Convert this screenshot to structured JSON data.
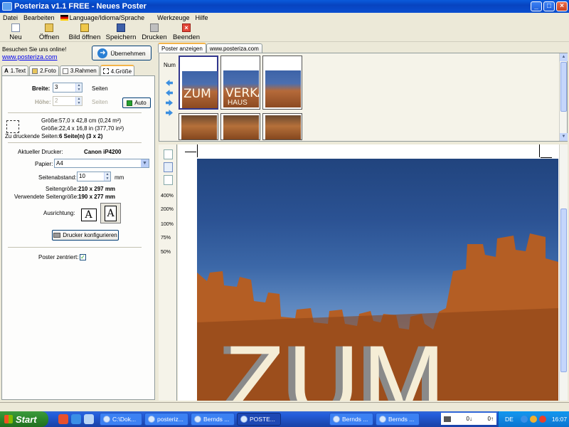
{
  "window": {
    "title": "Posteriza v1.1 FREE - Neues Poster",
    "controls": [
      "_",
      "□",
      "×"
    ]
  },
  "menu": {
    "items": [
      "Datei",
      "Bearbeiten",
      "Language/Idioma/Sprache",
      "Werkzeuge",
      "Hilfe"
    ]
  },
  "toolbar": {
    "new": "Neu",
    "open": "Öffnen",
    "open_image": "Bild öffnen",
    "save": "Speichern",
    "print": "Drucken",
    "quit": "Beenden"
  },
  "left": {
    "visit_text": "Besuchen Sie uns online!",
    "visit_link": "www.posteriza.com",
    "apply_button": "Übernehmen",
    "tabs": [
      "1.Text",
      "2.Foto",
      "3.Rahmen",
      "4.Größe"
    ],
    "width_label": "Breite:",
    "width_value": "3",
    "width_unit": "Seiten",
    "height_label": "Höhe:",
    "height_value": "2",
    "height_unit": "Seiten",
    "auto_button": "Auto",
    "size_label_1": "Größe:",
    "size_value_1": "57,0 x 42,8 cm (0,24 m²)",
    "size_label_2": "Größe:",
    "size_value_2": "22,4 x 16,8 in (377,70 in²)",
    "pages_label": "Zu druckende Seiten:",
    "pages_value": "6 Seite(n) (3 x 2)",
    "printer_label": "Aktueller Drucker:",
    "printer_value": "Canon iP4200",
    "paper_label": "Papier:",
    "paper_value": "A4",
    "margin_label": "Seitenabstand:",
    "margin_value": "10",
    "margin_unit": "mm",
    "pagesize_label": "Seitengröße:",
    "pagesize_value": "210 x 297 mm",
    "usedsize_label": "Verwendete Seitengröße:",
    "usedsize_value": "190 x 277 mm",
    "orientation_label": "Ausrichtung:",
    "orientation_glyph": "A",
    "printer_config_button": "Drucker konfigurieren",
    "centered_label": "Poster zentriert:",
    "centered_checked": true
  },
  "right": {
    "tabs": [
      "Poster anzeigen",
      "www.posteriza.com"
    ],
    "num_label": "Num",
    "thumb_text_1": "ZUM",
    "thumb_text_2": "VERKAUF",
    "thumb_text_3": "HAUS",
    "zoom_levels": [
      "400%",
      "200%",
      "100%",
      "75%",
      "50%"
    ],
    "poster_text": "ZUM"
  },
  "taskbar": {
    "start": "Start",
    "tasks": [
      "C:\\Dok...",
      "posteriz...",
      "Bernds ...",
      "POSTE...",
      "Bernds ...",
      "Bernds ..."
    ],
    "tray_left": "0↓",
    "tray_right": "0↑",
    "lang": "DE",
    "clock": "16:07"
  }
}
